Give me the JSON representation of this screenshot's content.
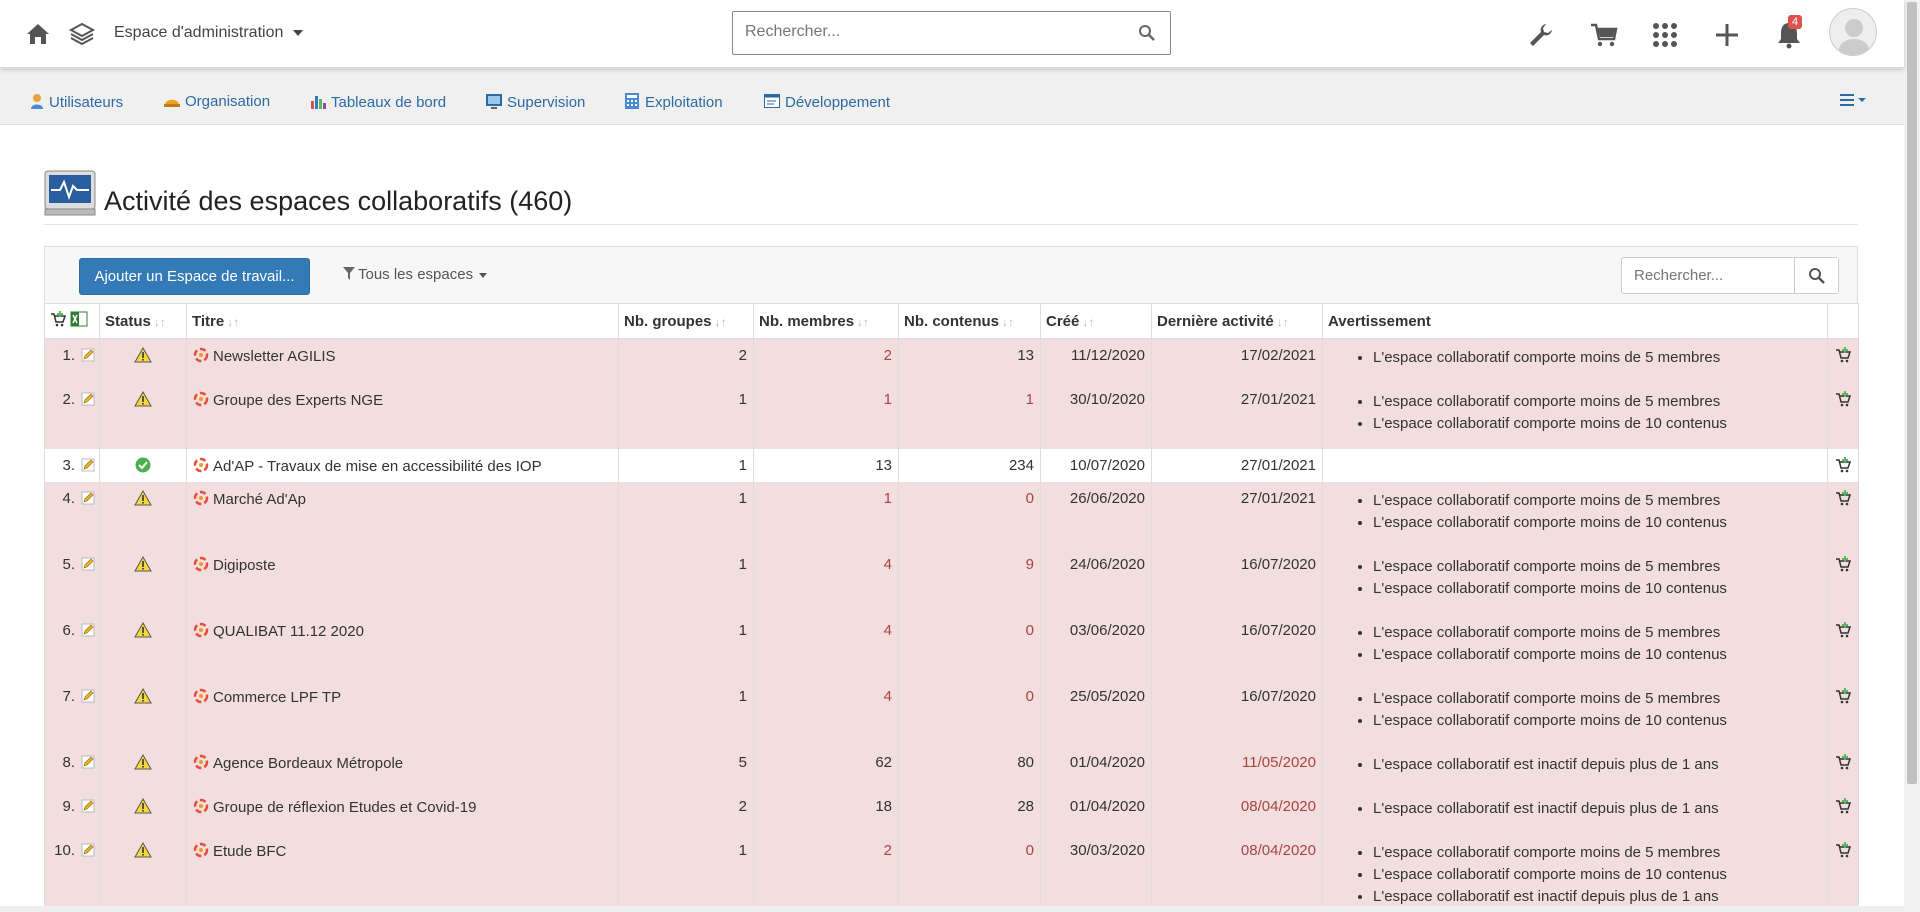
{
  "topbar": {
    "space_label": "Espace d'administration",
    "search_placeholder": "Rechercher...",
    "notification_count": "4"
  },
  "nav": {
    "items": [
      {
        "label": "Utilisateurs",
        "icon": "user-icon"
      },
      {
        "label": "Organisation",
        "icon": "helmet-icon"
      },
      {
        "label": "Tableaux de bord",
        "icon": "bar-chart-icon"
      },
      {
        "label": "Supervision",
        "icon": "monitor-icon"
      },
      {
        "label": "Exploitation",
        "icon": "calculator-icon"
      },
      {
        "label": "Développement",
        "icon": "window-icon"
      }
    ]
  },
  "page": {
    "title": "Activité des espaces collaboratifs (460)"
  },
  "toolbar": {
    "add_label": "Ajouter un Espace de travail...",
    "filter_label": "Tous les espaces",
    "search_placeholder": "Rechercher..."
  },
  "table": {
    "headers": [
      "Status",
      "Titre",
      "Nb. groupes",
      "Nb. membres",
      "Nb. contenus",
      "Créé",
      "Dernière activité",
      "Avertissement"
    ],
    "rows": [
      {
        "index": "1.",
        "status": "warning",
        "title": "Newsletter AGILIS",
        "groups": "2",
        "members": "2",
        "contents": "13",
        "created": "11/12/2020",
        "last": "17/02/2021",
        "members_red": true,
        "contents_red": false,
        "last_red": false,
        "warnings": [
          "L'espace collaboratif comporte moins de 5 membres"
        ]
      },
      {
        "index": "2.",
        "status": "warning",
        "title": "Groupe des Experts NGE",
        "groups": "1",
        "members": "1",
        "contents": "1",
        "created": "30/10/2020",
        "last": "27/01/2021",
        "members_red": true,
        "contents_red": true,
        "last_red": false,
        "warnings": [
          "L'espace collaboratif comporte moins de 5 membres",
          "L'espace collaboratif comporte moins de 10 contenus"
        ]
      },
      {
        "index": "3.",
        "status": "ok",
        "title": "Ad'AP - Travaux de mise en accessibilité des IOP",
        "groups": "1",
        "members": "13",
        "contents": "234",
        "created": "10/07/2020",
        "last": "27/01/2021",
        "members_red": false,
        "contents_red": false,
        "last_red": false,
        "warnings": []
      },
      {
        "index": "4.",
        "status": "warning",
        "title": "Marché Ad'Ap",
        "groups": "1",
        "members": "1",
        "contents": "0",
        "created": "26/06/2020",
        "last": "27/01/2021",
        "members_red": true,
        "contents_red": true,
        "last_red": false,
        "warnings": [
          "L'espace collaboratif comporte moins de 5 membres",
          "L'espace collaboratif comporte moins de 10 contenus"
        ]
      },
      {
        "index": "5.",
        "status": "warning",
        "title": "Digiposte",
        "groups": "1",
        "members": "4",
        "contents": "9",
        "created": "24/06/2020",
        "last": "16/07/2020",
        "members_red": true,
        "contents_red": true,
        "last_red": false,
        "warnings": [
          "L'espace collaboratif comporte moins de 5 membres",
          "L'espace collaboratif comporte moins de 10 contenus"
        ]
      },
      {
        "index": "6.",
        "status": "warning",
        "title": "QUALIBAT 11.12 2020",
        "groups": "1",
        "members": "4",
        "contents": "0",
        "created": "03/06/2020",
        "last": "16/07/2020",
        "members_red": true,
        "contents_red": true,
        "last_red": false,
        "warnings": [
          "L'espace collaboratif comporte moins de 5 membres",
          "L'espace collaboratif comporte moins de 10 contenus"
        ]
      },
      {
        "index": "7.",
        "status": "warning",
        "title": "Commerce LPF TP",
        "groups": "1",
        "members": "4",
        "contents": "0",
        "created": "25/05/2020",
        "last": "16/07/2020",
        "members_red": true,
        "contents_red": true,
        "last_red": false,
        "warnings": [
          "L'espace collaboratif comporte moins de 5 membres",
          "L'espace collaboratif comporte moins de 10 contenus"
        ]
      },
      {
        "index": "8.",
        "status": "warning",
        "title": "Agence Bordeaux Métropole",
        "groups": "5",
        "members": "62",
        "contents": "80",
        "created": "01/04/2020",
        "last": "11/05/2020",
        "members_red": false,
        "contents_red": false,
        "last_red": true,
        "warnings": [
          "L'espace collaboratif est inactif depuis plus de 1 ans"
        ]
      },
      {
        "index": "9.",
        "status": "warning",
        "title": "Groupe de réflexion Etudes et Covid-19",
        "groups": "2",
        "members": "18",
        "contents": "28",
        "created": "01/04/2020",
        "last": "08/04/2020",
        "members_red": false,
        "contents_red": false,
        "last_red": true,
        "warnings": [
          "L'espace collaboratif est inactif depuis plus de 1 ans"
        ]
      },
      {
        "index": "10.",
        "status": "warning",
        "title": "Etude BFC",
        "groups": "1",
        "members": "2",
        "contents": "0",
        "created": "30/03/2020",
        "last": "08/04/2020",
        "members_red": true,
        "contents_red": true,
        "last_red": true,
        "warnings": [
          "L'espace collaboratif comporte moins de 5 membres",
          "L'espace collaboratif comporte moins de 10 contenus",
          "L'espace collaboratif est inactif depuis plus de 1 ans"
        ]
      }
    ]
  }
}
